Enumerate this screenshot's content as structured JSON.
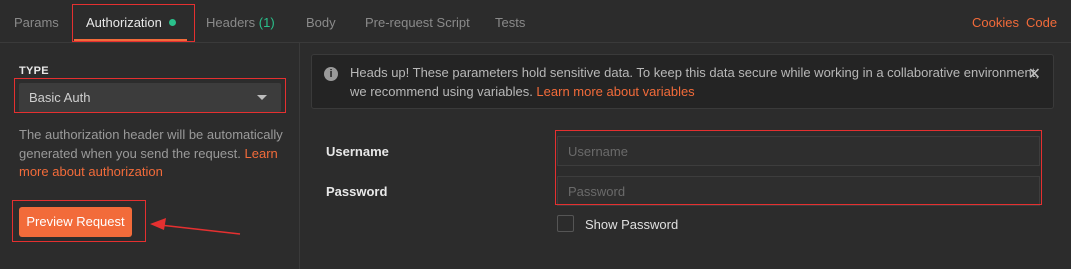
{
  "tabs": [
    {
      "label": "Params"
    },
    {
      "label": "Authorization",
      "active": true,
      "indicator": "green-dot"
    },
    {
      "label": "Headers",
      "count": "(1)"
    },
    {
      "label": "Body"
    },
    {
      "label": "Pre-request Script"
    },
    {
      "label": "Tests"
    }
  ],
  "header_links": {
    "cookies": "Cookies",
    "code": "Code"
  },
  "left": {
    "type_label": "TYPE",
    "type_value": "Basic Auth",
    "description": "The authorization header will be automatically generated when you send the request. ",
    "description_link": "Learn more about authorization",
    "preview_button": "Preview Request"
  },
  "notice": {
    "icon": "info-icon",
    "text": "Heads up! These parameters hold sensitive data. To keep this data secure while working in a collaborative environment, we recommend using variables. ",
    "link": "Learn more about variables"
  },
  "form": {
    "username_label": "Username",
    "username_placeholder": "Username",
    "username_value": "",
    "password_label": "Password",
    "password_placeholder": "Password",
    "password_value": "",
    "show_password_label": "Show Password",
    "show_password_checked": false
  },
  "colors": {
    "accent": "#f26b3a",
    "indicator_green": "#2ac08b",
    "annotation_red": "#e53030",
    "background": "#2c2c2c"
  }
}
